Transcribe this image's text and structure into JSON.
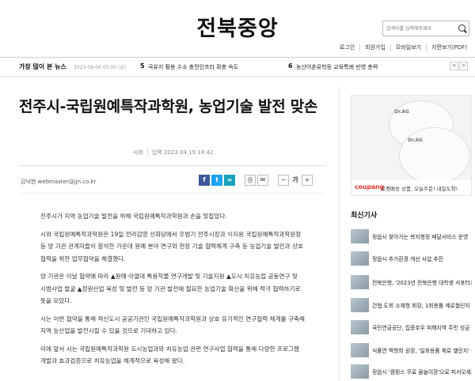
{
  "header": {
    "logo": "전북중앙",
    "search_placeholder": "검색어를 입력해주세요",
    "utility_links": [
      "로그인",
      "회원가입",
      "모바일보기",
      "지면보기(PDF)"
    ]
  },
  "popular": {
    "title": "가장 많이 본 뉴스",
    "timestamp": "2023-08-04 05:00 (금)",
    "items": [
      {
        "rank": "5",
        "title": "국유지 활용 수소 충전인프라 확충 속도"
      },
      {
        "rank": "6",
        "title": "농산어촌유학등 교육특례 반영 총력"
      }
    ],
    "prev": "<",
    "next": ">"
  },
  "article": {
    "headline": "전주시-국립원예특작과학원, 농업기술 발전 맞손",
    "section": "사회",
    "date": "입력 2023.04.19 18:42",
    "byline": "김낙현 webmaster@jjn.co.kr",
    "paragraphs": [
      "전주시가 지역 농업기술 발전을 위해 국립원예특작과학원과 손을 맞잡았다.",
      "시와 국립원예특작과학원은 19일 전라감영 선화당에서 우범기 전주시장과 이지원 국립원예특작과학원장 등 양 기관 관계자들이 참석한 가운데 원예 분야 연구와 현장 기술 협력체계 구축 등 농업기술 발전과 상호협력을 위한 업무협약을 체결했다.",
      "양 기관은 이날 협약에 따라 ▲원예·아열대 특용작물 연구개발 및 기술지원 ▲도시 치유농업 공동연구 및 시범사업 발굴 ▲정원산업 육성 및 발전 등 양 기관 발전에 필요한 농업기술 확산을 위해 적극 협력하기로 뜻을 모았다.",
      "시는 이번 협약을 통해 혁신도시 공공기관인 국립원예특작과학원과 상호 유기적인 연구협력 체계를 구축해 지역 농산업을 발전시킬 수 있을 것으로 기대하고 있다.",
      "이에 앞서 시는 국립원예특작과학원 도시농업과와 치유농업 관련 연구사업 협력을 통해 다양한 프로그램 개발과 효과검증으로 치유농업을 체계적으로 육성해 왔다."
    ]
  },
  "share": {
    "facebook": "f",
    "twitter": "t",
    "link": "∞",
    "print": "⎙",
    "mail": "✉",
    "font_minus": "−",
    "font_label": "가",
    "font_plus": "+"
  },
  "ad": {
    "product_label_1": "Dr.AG",
    "product_label_2": "Dr.AG",
    "brand": "coupang",
    "copy": "로켓배송 상품, 오늘주문! 내일도착!"
  },
  "sidebar": {
    "title": "최신기사",
    "items": [
      "정읍시 찾아가는 복지행정 배달서비스 운영",
      "정읍시 추가환경 개선 사업 추진",
      "전북은행, '2023년 전북은행 대학생 서포터즈' 발대",
      "건협 도회 소재형 회장, 1회용품 제로챌린지 동참",
      "국민연금공단, 집중호우 피해지역 주민 성금 전달",
      "식품연 백형희 원장, '일회용품 제로 챌린지' 동참",
      "정읍시 '캠핑스 무료 물놀이장'으로 피서오세요"
    ]
  }
}
